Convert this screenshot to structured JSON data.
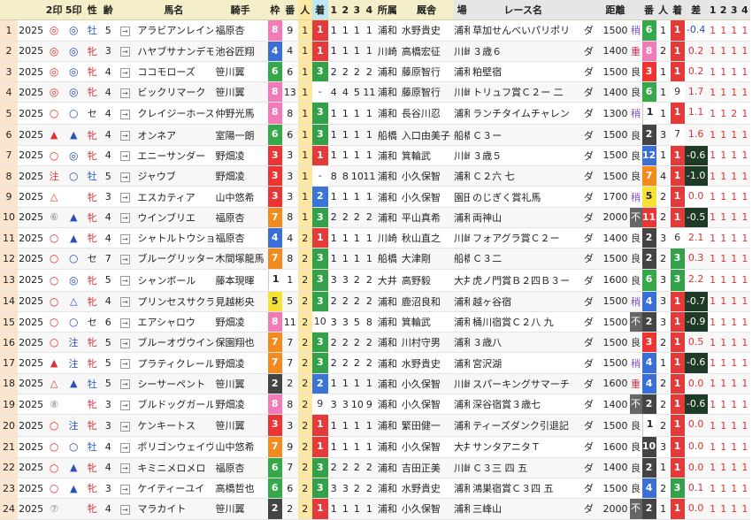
{
  "headers": {
    "no": "",
    "year": "",
    "m2": "2印",
    "m5": "5印",
    "sex": "性",
    "age": "齢",
    "link": "",
    "name": "馬名",
    "jockey": "騎手",
    "waku": "枠",
    "ban": "番",
    "ninki": "人",
    "chaku": "着",
    "c1": "1",
    "c2": "2",
    "c3": "3",
    "c4": "4",
    "shozoku": "所属",
    "trainer": "厩舎",
    "ba": "場",
    "race": "レース名",
    "baba": "",
    "dist": "距離",
    "cond": "",
    "ban2": "番",
    "nin2": "人",
    "ch2": "着",
    "diff": "差",
    "p1": "1",
    "p2": "2",
    "p3": "3",
    "p4": "4"
  },
  "rows": [
    {
      "no": "1",
      "year": "2025",
      "m2": "◎",
      "m5": "◎",
      "sex": "牡",
      "age": "5",
      "name": "アラビアンレイン",
      "jockey": "福原杏",
      "waku": "8",
      "ban": "9",
      "ninki": "1",
      "chaku": "1",
      "c1": "1",
      "c2": "1",
      "c3": "1",
      "c4": "1",
      "shozoku": "浦和",
      "trainer": "水野貴史",
      "ba": "浦和",
      "race": "草加せんべいパリポリ",
      "baba": "ダ",
      "dist": "1500",
      "cond": "稍",
      "ban2": "6",
      "nin2": "1",
      "ch2": "1",
      "diff": "-0.4",
      "p1": "1",
      "p2": "1",
      "p3": "1",
      "p4": "1"
    },
    {
      "no": "2",
      "year": "2025",
      "m2": "◎",
      "m5": "◎",
      "sex": "牝",
      "age": "3",
      "name": "ハヤブサナンデモノ",
      "jockey": "池谷匠翔",
      "waku": "4",
      "ban": "4",
      "ninki": "1",
      "chaku": "1",
      "c1": "1",
      "c2": "1",
      "c3": "1",
      "c4": "1",
      "shozoku": "川崎",
      "trainer": "高橋宏征",
      "ba": "川崎",
      "race": "３歳６",
      "baba": "ダ",
      "dist": "1400",
      "cond": "重",
      "ban2": "8",
      "nin2": "2",
      "ch2": "1",
      "diff": "0.2",
      "p1": "1",
      "p2": "1",
      "p3": "1",
      "p4": "1"
    },
    {
      "no": "3",
      "year": "2025",
      "m2": "◎",
      "m5": "◎",
      "sex": "牝",
      "age": "4",
      "name": "ココモローズ",
      "jockey": "笹川翼",
      "waku": "6",
      "ban": "6",
      "ninki": "1",
      "chaku": "3",
      "c1": "2",
      "c2": "2",
      "c3": "2",
      "c4": "2",
      "shozoku": "浦和",
      "trainer": "藤原智行",
      "ba": "浦和",
      "race": "粕壁宿",
      "baba": "ダ",
      "dist": "1500",
      "cond": "良",
      "ban2": "3",
      "nin2": "1",
      "ch2": "1",
      "diff": "0.2",
      "p1": "1",
      "p2": "1",
      "p3": "1",
      "p4": "1"
    },
    {
      "no": "4",
      "year": "2025",
      "m2": "◎",
      "m5": "◎",
      "sex": "牝",
      "age": "4",
      "name": "ビックリマーク",
      "jockey": "笹川翼",
      "waku": "8",
      "ban": "13",
      "ninki": "1",
      "chaku": "-",
      "c1": "4",
      "c2": "4",
      "c3": "5",
      "c4": "11",
      "shozoku": "浦和",
      "trainer": "藤原智行",
      "ba": "川崎",
      "race": "トリュフ賞Ｃ２ー 二",
      "baba": "ダ",
      "dist": "1400",
      "cond": "良",
      "ban2": "6",
      "nin2": "1",
      "ch2": "9",
      "diff": "1.7",
      "p1": "1",
      "p2": "1",
      "p3": "1",
      "p4": "1"
    },
    {
      "no": "5",
      "year": "2025",
      "m2": "○",
      "m5": "○",
      "sex": "セ",
      "age": "4",
      "name": "クレイジーホース",
      "jockey": "仲野光馬",
      "waku": "8",
      "ban": "8",
      "ninki": "1",
      "chaku": "3",
      "c1": "1",
      "c2": "1",
      "c3": "1",
      "c4": "1",
      "shozoku": "浦和",
      "trainer": "長谷川忍",
      "ba": "浦和",
      "race": "ランチタイムチャレン",
      "baba": "ダ",
      "dist": "1300",
      "cond": "稍",
      "ban2": "1",
      "nin2": "1",
      "ch2": "1",
      "diff": "1.1",
      "p1": "1",
      "p2": "1",
      "p3": "2",
      "p4": "1"
    },
    {
      "no": "6",
      "year": "2025",
      "m2": "▲",
      "m5": "▲",
      "sex": "牝",
      "age": "4",
      "name": "オンネア",
      "jockey": "室陽一朗",
      "waku": "6",
      "ban": "6",
      "ninki": "1",
      "chaku": "3",
      "c1": "1",
      "c2": "1",
      "c3": "1",
      "c4": "1",
      "shozoku": "船橋",
      "trainer": "入口由美子",
      "ba": "船橋",
      "race": "Ｃ３ー",
      "baba": "ダ",
      "dist": "1500",
      "cond": "良",
      "ban2": "2",
      "nin2": "3",
      "ch2": "7",
      "diff": "1.6",
      "p1": "1",
      "p2": "1",
      "p3": "1",
      "p4": "1"
    },
    {
      "no": "7",
      "year": "2025",
      "m2": "○",
      "m5": "◎",
      "sex": "牝",
      "age": "4",
      "name": "エニーサンダー",
      "jockey": "野畑凌",
      "waku": "3",
      "ban": "3",
      "ninki": "1",
      "chaku": "1",
      "c1": "1",
      "c2": "1",
      "c3": "1",
      "c4": "1",
      "shozoku": "浦和",
      "trainer": "箕輪武",
      "ba": "川崎",
      "race": "３歳５",
      "baba": "ダ",
      "dist": "1500",
      "cond": "良",
      "ban2": "12",
      "nin2": "1",
      "ch2": "1",
      "diff": "-0.6",
      "p1": "1",
      "p2": "1",
      "p3": "1",
      "p4": "1"
    },
    {
      "no": "8",
      "year": "2025",
      "m2": "注",
      "m5": "○",
      "sex": "牡",
      "age": "5",
      "name": "ジャウブ",
      "jockey": "野畑凌",
      "waku": "3",
      "ban": "3",
      "ninki": "1",
      "chaku": "-",
      "c1": "8",
      "c2": "8",
      "c3": "10",
      "c4": "11",
      "shozoku": "浦和",
      "trainer": "小久保智",
      "ba": "浦和",
      "race": "Ｃ２六 七",
      "baba": "ダ",
      "dist": "1500",
      "cond": "良",
      "ban2": "7",
      "nin2": "4",
      "ch2": "1",
      "diff": "-1.0",
      "p1": "1",
      "p2": "1",
      "p3": "1",
      "p4": "1"
    },
    {
      "no": "9",
      "year": "2025",
      "m2": "△",
      "m5": "",
      "sex": "牝",
      "age": "3",
      "name": "エスカティア",
      "jockey": "山中悠希",
      "waku": "3",
      "ban": "3",
      "ninki": "1",
      "chaku": "2",
      "c1": "1",
      "c2": "1",
      "c3": "1",
      "c4": "1",
      "shozoku": "浦和",
      "trainer": "小久保智",
      "ba": "園田",
      "race": "のじぎく賞礼馬",
      "baba": "ダ",
      "dist": "1700",
      "cond": "稍",
      "ban2": "5",
      "nin2": "2",
      "ch2": "1",
      "diff": "0.0",
      "p1": "1",
      "p2": "1",
      "p3": "1",
      "p4": "1"
    },
    {
      "no": "10",
      "year": "2025",
      "m2": "⑥",
      "m5": "▲",
      "sex": "牝",
      "age": "4",
      "name": "ウインブリエ",
      "jockey": "福原杏",
      "waku": "7",
      "ban": "8",
      "ninki": "1",
      "chaku": "3",
      "c1": "2",
      "c2": "2",
      "c3": "2",
      "c4": "2",
      "shozoku": "浦和",
      "trainer": "平山真希",
      "ba": "浦和",
      "race": "両神山",
      "baba": "ダ",
      "dist": "2000",
      "cond": "不",
      "ban2": "11",
      "nin2": "2",
      "ch2": "1",
      "diff": "-0.5",
      "p1": "1",
      "p2": "1",
      "p3": "1",
      "p4": "1"
    },
    {
      "no": "11",
      "year": "2025",
      "m2": "○",
      "m5": "▲",
      "sex": "牝",
      "age": "4",
      "name": "シャトルトウショウ",
      "jockey": "福原杏",
      "waku": "4",
      "ban": "4",
      "ninki": "2",
      "chaku": "1",
      "c1": "1",
      "c2": "1",
      "c3": "1",
      "c4": "1",
      "shozoku": "川崎",
      "trainer": "秋山直之",
      "ba": "川崎",
      "race": "フォアグラ賞Ｃ２ー",
      "baba": "ダ",
      "dist": "1400",
      "cond": "良",
      "ban2": "2",
      "nin2": "3",
      "ch2": "6",
      "diff": "2.1",
      "p1": "1",
      "p2": "1",
      "p3": "1",
      "p4": "1"
    },
    {
      "no": "12",
      "year": "2025",
      "m2": "○",
      "m5": "○",
      "sex": "セ",
      "age": "7",
      "name": "ブルーグリッター",
      "jockey": "木間塚龍馬",
      "waku": "7",
      "ban": "8",
      "ninki": "2",
      "chaku": "3",
      "c1": "1",
      "c2": "1",
      "c3": "1",
      "c4": "1",
      "shozoku": "船橋",
      "trainer": "大津剛",
      "ba": "船橋",
      "race": "Ｃ３二",
      "baba": "ダ",
      "dist": "1500",
      "cond": "良",
      "ban2": "2",
      "nin2": "2",
      "ch2": "3",
      "diff": "0.3",
      "p1": "1",
      "p2": "1",
      "p3": "1",
      "p4": "1"
    },
    {
      "no": "13",
      "year": "2025",
      "m2": "○",
      "m5": "◎",
      "sex": "牝",
      "age": "5",
      "name": "シャンボール",
      "jockey": "藤本現暉",
      "waku": "1",
      "ban": "1",
      "ninki": "2",
      "chaku": "3",
      "c1": "3",
      "c2": "3",
      "c3": "2",
      "c4": "2",
      "shozoku": "大井",
      "trainer": "高野毅",
      "ba": "大井",
      "race": "虎ノ門賞Ｂ２四Ｂ３ー",
      "baba": "ダ",
      "dist": "1600",
      "cond": "良",
      "ban2": "6",
      "nin2": "3",
      "ch2": "3",
      "diff": "2.2",
      "p1": "1",
      "p2": "1",
      "p3": "1",
      "p4": "1"
    },
    {
      "no": "14",
      "year": "2025",
      "m2": "○",
      "m5": "△",
      "sex": "牝",
      "age": "4",
      "name": "プリンセスサクラ",
      "jockey": "見越彬央",
      "waku": "5",
      "ban": "5",
      "ninki": "2",
      "chaku": "3",
      "c1": "2",
      "c2": "2",
      "c3": "2",
      "c4": "2",
      "shozoku": "浦和",
      "trainer": "鹿沼良和",
      "ba": "浦和",
      "race": "越ヶ谷宿",
      "baba": "ダ",
      "dist": "1500",
      "cond": "稍",
      "ban2": "4",
      "nin2": "3",
      "ch2": "1",
      "diff": "-0.7",
      "p1": "1",
      "p2": "1",
      "p3": "1",
      "p4": "1"
    },
    {
      "no": "15",
      "year": "2025",
      "m2": "○",
      "m5": "○",
      "sex": "セ",
      "age": "6",
      "name": "エアシャロウ",
      "jockey": "野畑凌",
      "waku": "8",
      "ban": "11",
      "ninki": "2",
      "chaku": "10",
      "c1": "3",
      "c2": "3",
      "c3": "5",
      "c4": "8",
      "shozoku": "浦和",
      "trainer": "箕輪武",
      "ba": "浦和",
      "race": "桶川宿賞Ｃ２八 九",
      "baba": "ダ",
      "dist": "1500",
      "cond": "不",
      "ban2": "2",
      "nin2": "3",
      "ch2": "1",
      "diff": "-0.9",
      "p1": "1",
      "p2": "1",
      "p3": "1",
      "p4": "1"
    },
    {
      "no": "16",
      "year": "2025",
      "m2": "○",
      "m5": "注",
      "sex": "牝",
      "age": "5",
      "name": "ブルーオヴウインド",
      "jockey": "保園翔也",
      "waku": "7",
      "ban": "7",
      "ninki": "2",
      "chaku": "3",
      "c1": "2",
      "c2": "2",
      "c3": "2",
      "c4": "2",
      "shozoku": "浦和",
      "trainer": "川村守男",
      "ba": "浦和",
      "race": "３歳八",
      "baba": "ダ",
      "dist": "1500",
      "cond": "良",
      "ban2": "3",
      "nin2": "2",
      "ch2": "1",
      "diff": "0.5",
      "p1": "1",
      "p2": "1",
      "p3": "1",
      "p4": "1"
    },
    {
      "no": "17",
      "year": "2025",
      "m2": "▲",
      "m5": "注",
      "sex": "牝",
      "age": "5",
      "name": "プラティクレール",
      "jockey": "野畑凌",
      "waku": "7",
      "ban": "7",
      "ninki": "2",
      "chaku": "3",
      "c1": "2",
      "c2": "2",
      "c3": "2",
      "c4": "2",
      "shozoku": "浦和",
      "trainer": "水野貴史",
      "ba": "浦和",
      "race": "宮沢湖",
      "baba": "ダ",
      "dist": "1500",
      "cond": "稍",
      "ban2": "4",
      "nin2": "1",
      "ch2": "1",
      "diff": "-0.6",
      "p1": "1",
      "p2": "1",
      "p3": "1",
      "p4": "1"
    },
    {
      "no": "18",
      "year": "2025",
      "m2": "△",
      "m5": "▲",
      "sex": "牡",
      "age": "5",
      "name": "シーサーペント",
      "jockey": "笹川翼",
      "waku": "2",
      "ban": "2",
      "ninki": "2",
      "chaku": "2",
      "c1": "1",
      "c2": "1",
      "c3": "1",
      "c4": "1",
      "shozoku": "浦和",
      "trainer": "小久保智",
      "ba": "川崎",
      "race": "スパーキングサマーチ",
      "baba": "ダ",
      "dist": "1600",
      "cond": "重",
      "ban2": "4",
      "nin2": "2",
      "ch2": "1",
      "diff": "0.0",
      "p1": "1",
      "p2": "1",
      "p3": "1",
      "p4": "1"
    },
    {
      "no": "19",
      "year": "2025",
      "m2": "⑧",
      "m5": "",
      "sex": "牝",
      "age": "3",
      "name": "ブルドッグガール",
      "jockey": "野畑凌",
      "waku": "8",
      "ban": "8",
      "ninki": "2",
      "chaku": "9",
      "c1": "3",
      "c2": "3",
      "c3": "10",
      "c4": "9",
      "shozoku": "浦和",
      "trainer": "小久保智",
      "ba": "浦和",
      "race": "深谷宿賞３歳七",
      "baba": "ダ",
      "dist": "1400",
      "cond": "不",
      "ban2": "2",
      "nin2": "2",
      "ch2": "1",
      "diff": "-0.6",
      "p1": "1",
      "p2": "1",
      "p3": "1",
      "p4": "1"
    },
    {
      "no": "20",
      "year": "2025",
      "m2": "○",
      "m5": "注",
      "sex": "牝",
      "age": "3",
      "name": "ケンキートス",
      "jockey": "笹川翼",
      "waku": "3",
      "ban": "3",
      "ninki": "2",
      "chaku": "1",
      "c1": "1",
      "c2": "1",
      "c3": "1",
      "c4": "1",
      "shozoku": "浦和",
      "trainer": "繁田健一",
      "ba": "浦和",
      "race": "ティーズダンク引退記",
      "baba": "ダ",
      "dist": "1500",
      "cond": "良",
      "ban2": "1",
      "nin2": "2",
      "ch2": "1",
      "diff": "0.0",
      "p1": "1",
      "p2": "1",
      "p3": "1",
      "p4": "1"
    },
    {
      "no": "21",
      "year": "2025",
      "m2": "○",
      "m5": "○",
      "sex": "牡",
      "age": "4",
      "name": "ポリゴンウェイヴ",
      "jockey": "山中悠希",
      "waku": "7",
      "ban": "9",
      "ninki": "2",
      "chaku": "1",
      "c1": "1",
      "c2": "1",
      "c3": "1",
      "c4": "1",
      "shozoku": "浦和",
      "trainer": "小久保智",
      "ba": "大井",
      "race": "サンタアニタＴ",
      "baba": "ダ",
      "dist": "1600",
      "cond": "良",
      "ban2": "10",
      "nin2": "3",
      "ch2": "1",
      "diff": "0.0",
      "p1": "1",
      "p2": "1",
      "p3": "1",
      "p4": "1"
    },
    {
      "no": "22",
      "year": "2025",
      "m2": "○",
      "m5": "▲",
      "sex": "牝",
      "age": "4",
      "name": "キミニメロメロ",
      "jockey": "福原杏",
      "waku": "6",
      "ban": "7",
      "ninki": "2",
      "chaku": "3",
      "c1": "2",
      "c2": "2",
      "c3": "2",
      "c4": "2",
      "shozoku": "浦和",
      "trainer": "吉田正美",
      "ba": "川崎",
      "race": "Ｃ３三 四 五",
      "baba": "ダ",
      "dist": "1400",
      "cond": "良",
      "ban2": "2",
      "nin2": "1",
      "ch2": "1",
      "diff": "0.0",
      "p1": "1",
      "p2": "1",
      "p3": "1",
      "p4": "1"
    },
    {
      "no": "23",
      "year": "2025",
      "m2": "○",
      "m5": "▲",
      "sex": "牝",
      "age": "3",
      "name": "ケイティーユイ",
      "jockey": "高橋哲也",
      "waku": "6",
      "ban": "6",
      "ninki": "2",
      "chaku": "3",
      "c1": "3",
      "c2": "3",
      "c3": "2",
      "c4": "2",
      "shozoku": "浦和",
      "trainer": "水野貴史",
      "ba": "浦和",
      "race": "鴻巣宿賞Ｃ３四 五",
      "baba": "ダ",
      "dist": "1500",
      "cond": "良",
      "ban2": "4",
      "nin2": "2",
      "ch2": "3",
      "diff": "0.1",
      "p1": "1",
      "p2": "1",
      "p3": "1",
      "p4": "1"
    },
    {
      "no": "24",
      "year": "2025",
      "m2": "⑦",
      "m5": "",
      "sex": "牝",
      "age": "4",
      "name": "マラカイト",
      "jockey": "笹川翼",
      "waku": "2",
      "ban": "2",
      "ninki": "2",
      "chaku": "1",
      "c1": "1",
      "c2": "1",
      "c3": "1",
      "c4": "1",
      "shozoku": "浦和",
      "trainer": "小久保智",
      "ba": "浦和",
      "race": "三峰山",
      "baba": "ダ",
      "dist": "2000",
      "cond": "不",
      "ban2": "2",
      "nin2": "1",
      "ch2": "1",
      "diff": "0.0",
      "p1": "1",
      "p2": "1",
      "p3": "1",
      "p4": "1"
    }
  ]
}
